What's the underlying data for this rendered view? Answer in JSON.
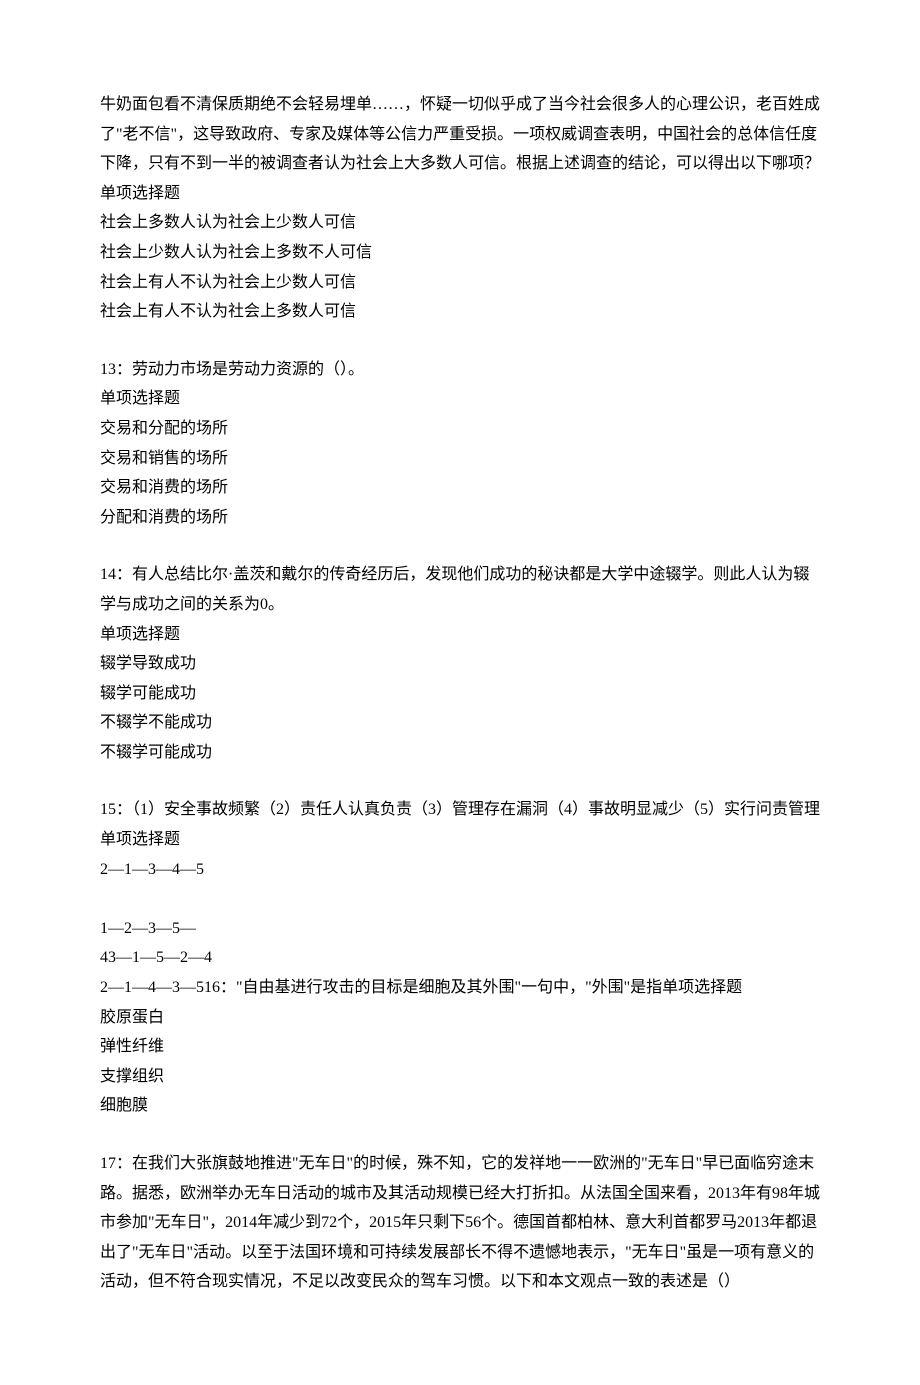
{
  "intro": "牛奶面包看不清保质期绝不会轻易埋单……，怀疑一切似乎成了当今社会很多人的心理公识，老百姓成了\"老不信\"，这导致政府、专家及媒体等公信力严重受损。一项权威调查表明，中国社会的总体信任度下降，只有不到一半的被调查者认为社会上大多数人可信。根据上述调查的结论，可以得出以下哪项？",
  "q12": {
    "type": "单项选择题",
    "options": [
      "社会上多数人认为社会上少数人可信",
      "社会上少数人认为社会上多数不人可信",
      "社会上有人不认为社会上少数人可信",
      "社会上有人不认为社会上多数人可信"
    ]
  },
  "q13": {
    "title": "13：劳动力市场是劳动力资源的（）。",
    "type": "单项选择题",
    "options": [
      "交易和分配的场所",
      "交易和销售的场所",
      "交易和消费的场所",
      "分配和消费的场所"
    ]
  },
  "q14": {
    "title": "14：有人总结比尔·盖茨和戴尔的传奇经历后，发现他们成功的秘诀都是大学中途辍学。则此人认为辍学与成功之间的关系为0。",
    "type": "单项选择题",
    "options": [
      "辍学导致成功",
      "辍学可能成功",
      "不辍学不能成功",
      "不辍学可能成功"
    ]
  },
  "q15": {
    "title": "15：（1）安全事故频繁（2）责任人认真负责（3）管理存在漏洞（4）事故明显减少（5）实行问责管理",
    "type": "单项选择题",
    "firstOption": "2—1—3—4—5",
    "midOptions": [
      "1—2—3—5—",
      "43—1—5—2—4"
    ],
    "combined": "2—1—4—3—516：\"自由基进行攻击的目标是细胞及其外围\"一句中，\"外围\"是指单项选择题",
    "q16options": [
      "胶原蛋白",
      "弹性纤维",
      "支撑组织",
      "细胞膜"
    ]
  },
  "q17": {
    "title": "17：在我们大张旗鼓地推进\"无车日\"的时候，殊不知，它的发祥地一一欧洲的\"无车日\"早已面临穷途末路。据悉，欧洲举办无车日活动的城市及其活动规模已经大打折扣。从法国全国来看，2013年有98年城市参加\"无车日\"，2014年减少到72个，2015年只剩下56个。德国首都柏林、意大利首都罗马2013年都退出了\"无车日\"活动。以至于法国环境和可持续发展部长不得不遗憾地表示，\"无车日\"虽是一项有意义的活动，但不符合现实情况，不足以改变民众的驾车习惯。以下和本文观点一致的表述是（）"
  }
}
